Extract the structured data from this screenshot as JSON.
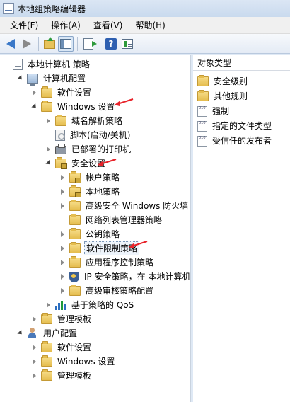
{
  "window": {
    "title": "本地组策略编辑器"
  },
  "menu": {
    "items": [
      "文件(F)",
      "操作(A)",
      "查看(V)",
      "帮助(H)"
    ]
  },
  "tree": {
    "nodes": [
      {
        "label": "本地计算机 策略",
        "level": 0,
        "expander": "none",
        "icon": "policy"
      },
      {
        "label": "计算机配置",
        "level": 1,
        "expander": "expanded",
        "icon": "computer"
      },
      {
        "label": "软件设置",
        "level": 2,
        "expander": "collapsed",
        "icon": "folder"
      },
      {
        "label": "Windows 设置",
        "level": 2,
        "expander": "expanded",
        "icon": "folder"
      },
      {
        "label": "域名解析策略",
        "level": 3,
        "expander": "collapsed",
        "icon": "folder"
      },
      {
        "label": "脚本(启动/关机)",
        "level": 3,
        "expander": "none",
        "icon": "script"
      },
      {
        "label": "已部署的打印机",
        "level": 3,
        "expander": "collapsed",
        "icon": "printer"
      },
      {
        "label": "安全设置",
        "level": 3,
        "expander": "expanded",
        "icon": "lock-folder"
      },
      {
        "label": "帐户策略",
        "level": 4,
        "expander": "collapsed",
        "icon": "lock-folder"
      },
      {
        "label": "本地策略",
        "level": 4,
        "expander": "collapsed",
        "icon": "lock-folder"
      },
      {
        "label": "高级安全 Windows 防火墙",
        "level": 4,
        "expander": "collapsed",
        "icon": "folder"
      },
      {
        "label": "网络列表管理器策略",
        "level": 4,
        "expander": "none",
        "icon": "folder"
      },
      {
        "label": "公钥策略",
        "level": 4,
        "expander": "collapsed",
        "icon": "folder"
      },
      {
        "label": "软件限制策略",
        "level": 4,
        "expander": "collapsed",
        "icon": "folder",
        "selected": true
      },
      {
        "label": "应用程序控制策略",
        "level": 4,
        "expander": "collapsed",
        "icon": "folder"
      },
      {
        "label": "IP 安全策略，在 本地计算机",
        "level": 4,
        "expander": "collapsed",
        "icon": "shield"
      },
      {
        "label": "高级审核策略配置",
        "level": 4,
        "expander": "collapsed",
        "icon": "folder"
      },
      {
        "label": "基于策略的 QoS",
        "level": 3,
        "expander": "collapsed",
        "icon": "chart"
      },
      {
        "label": "管理模板",
        "level": 2,
        "expander": "collapsed",
        "icon": "folder"
      },
      {
        "label": "用户配置",
        "level": 1,
        "expander": "expanded",
        "icon": "user"
      },
      {
        "label": "软件设置",
        "level": 2,
        "expander": "collapsed",
        "icon": "folder"
      },
      {
        "label": "Windows 设置",
        "level": 2,
        "expander": "collapsed",
        "icon": "folder"
      },
      {
        "label": "管理模板",
        "level": 2,
        "expander": "collapsed",
        "icon": "folder"
      }
    ]
  },
  "detail": {
    "column_header": "对象类型",
    "items": [
      {
        "label": "安全级别",
        "icon": "folder"
      },
      {
        "label": "其他规则",
        "icon": "folder"
      },
      {
        "label": "强制",
        "icon": "doc"
      },
      {
        "label": "指定的文件类型",
        "icon": "doc"
      },
      {
        "label": "受信任的发布者",
        "icon": "doc"
      }
    ]
  },
  "annotations": {
    "arrow_color": "#e8232a"
  }
}
